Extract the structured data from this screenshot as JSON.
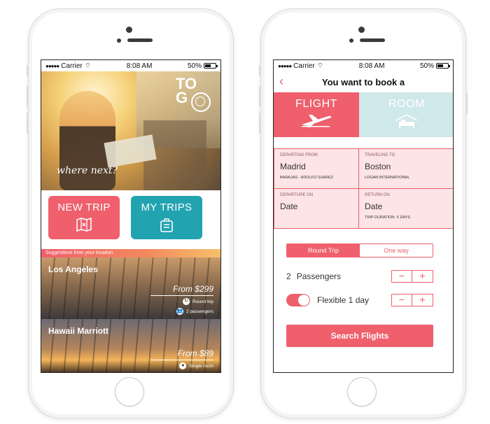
{
  "status_bar": {
    "carrier": "Carrier",
    "time": "8:08 AM",
    "battery": "50%",
    "battery_level": 0.5
  },
  "home": {
    "logo_line1": "TO",
    "logo_line2": "G",
    "tagline": "where next?",
    "new_trip_label": "NEW TRIP",
    "my_trips_label": "MY TRIPS",
    "suggestions_header": "Suggestions from your location",
    "suggestions": [
      {
        "name": "Los Angeles",
        "price": "From $299",
        "meta1": "Round trip",
        "meta2": "2 passengers"
      },
      {
        "name": "Hawaii Marriott",
        "price": "From $89",
        "meta1": "Single room"
      }
    ],
    "icons": {
      "new_trip": "map-icon",
      "my_trips": "suitcase-icon",
      "round_trip": "refresh-icon",
      "passengers": "people-icon",
      "single_room": "person-icon"
    }
  },
  "booking": {
    "back_label": "‹",
    "title": "You want to book a",
    "modes": {
      "flight": "FLIGHT",
      "room": "ROOM"
    },
    "fields": {
      "departing_label": "DEPARTING FROM",
      "departing_value": "Madrid",
      "departing_sub": "BARAJAS - ADOLFO SUAREZ",
      "traveling_label": "TRAVELING TO",
      "traveling_value": "Boston",
      "traveling_sub": "LOGAN INTERNATIONAL",
      "departure_label": "DEPARTURE ON",
      "departure_value": "Date",
      "return_label": "RETURN ON",
      "return_value": "Date",
      "return_sub": "TRIP DURATION: X DAYS"
    },
    "trip_type": {
      "selected": "Round Trip",
      "other": "One way"
    },
    "passengers_count": "2",
    "passengers_label": "Passengers",
    "flexible_label": "Flexible 1 day",
    "flexible_on": true,
    "stepper_minus": "−",
    "stepper_plus": "+",
    "search_button": "Search Flights"
  },
  "colors": {
    "accent": "#ef5f6c",
    "teal": "#22a3b0",
    "room_bg": "#cfe8ea",
    "field_bg": "#fde4e6"
  }
}
